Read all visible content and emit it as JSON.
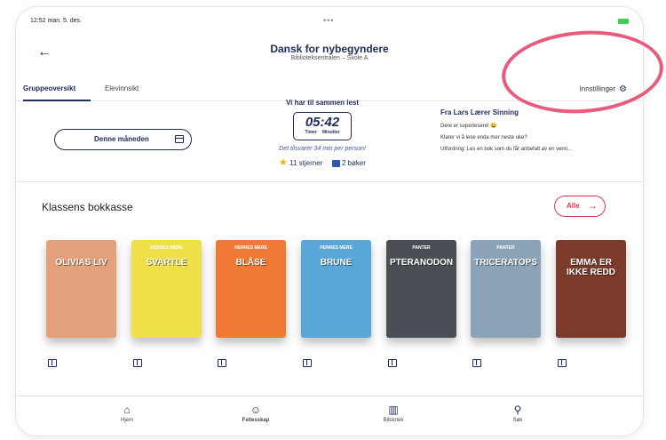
{
  "status_bar": {
    "time": "12:52",
    "date": "man. 5. des.",
    "dots": "•••"
  },
  "header": {
    "back_icon": "arrow-left-icon",
    "title": "Dansk for nybegyndere",
    "subtitle": "Biblioteksentralen – Skole A"
  },
  "tabs": [
    {
      "label": "Gruppeoversikt",
      "active": true
    },
    {
      "label": "Elevinnsikt",
      "active": false
    }
  ],
  "settings": {
    "label": "Innstillinger",
    "icon": "gear-icon"
  },
  "period_button": {
    "label": "Denne måneden",
    "icon": "calendar-icon"
  },
  "stats": {
    "title": "Vi har til sammen lest",
    "timer_value": "05:42",
    "unit_hours": "Timer",
    "unit_minutes": "Minutter",
    "average": "Det tilsvarer 34 min per person!",
    "stars": "11 stjerner",
    "books": "2 bøker"
  },
  "teacher_message": {
    "from": "Fra Lars Lærer Sinning",
    "lines": [
      "Dere er superlesere! 😀",
      "Klarer vi å lese enda mer neste uke?",
      "Utfordring: Les en bok som du får anbefalt av en venn..."
    ]
  },
  "shelf": {
    "title": "Klassens bokkasse",
    "all_label": "Alle",
    "books": [
      {
        "title": "OLIVIAS LIV",
        "top": "",
        "color": "#e3a07a"
      },
      {
        "title": "SVARTLE",
        "top": "HENNES MERE",
        "color": "#efe04a"
      },
      {
        "title": "BLÅSE",
        "top": "HENNES MERE",
        "color": "#f07a35"
      },
      {
        "title": "BRUNE",
        "top": "HENNES MERE",
        "color": "#5aa6d8"
      },
      {
        "title": "PTERANODON",
        "top": "PANTER",
        "color": "#4a4f55"
      },
      {
        "title": "TRICERATOPS",
        "top": "PANTER",
        "color": "#8aa3b7"
      },
      {
        "title": "EMMA ER IKKE REDD",
        "top": "",
        "color": "#7c3b2a"
      }
    ]
  },
  "nav": [
    {
      "label": "Hjem",
      "icon": "home-icon",
      "active": false
    },
    {
      "label": "Fellesskap",
      "icon": "community-icon",
      "active": true
    },
    {
      "label": "Bibliotek",
      "icon": "library-icon",
      "active": false
    },
    {
      "label": "Søk",
      "icon": "search-icon",
      "active": false
    }
  ],
  "colors": {
    "primary": "#1d2b5a",
    "accent": "#d23a53",
    "annotation": "#e95a7c"
  }
}
